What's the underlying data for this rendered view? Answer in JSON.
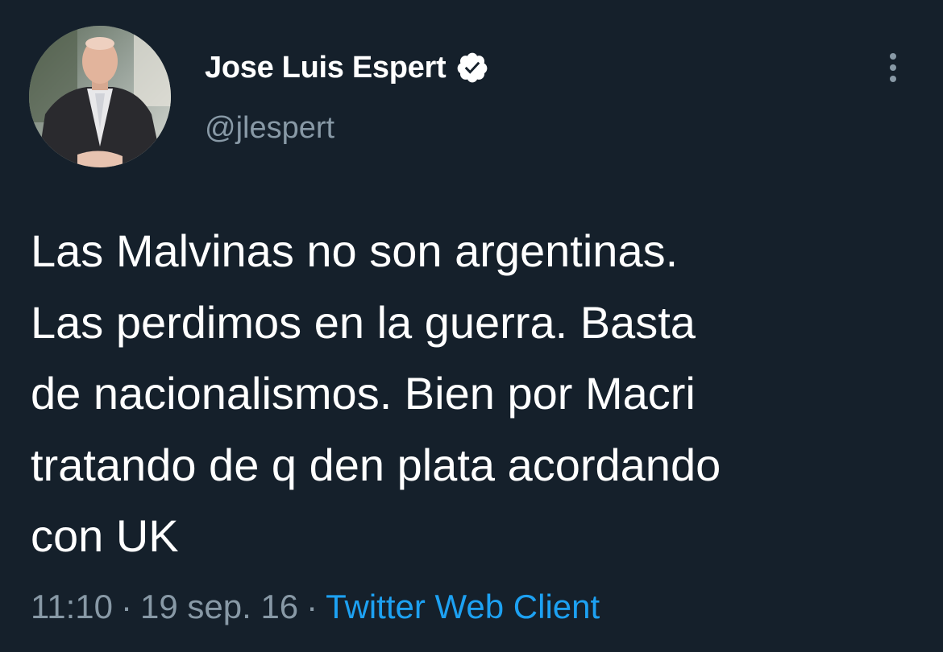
{
  "tweet": {
    "author": {
      "display_name": "Jose Luis Espert",
      "handle": "@jlespert",
      "verified": true,
      "verified_icon": "verified-badge-icon",
      "avatar_icon": "avatar"
    },
    "more_icon": "more-vertical-icon",
    "text_lines": [
      "Las Malvinas no son argentinas.",
      "Las perdimos en la guerra. Basta",
      "de nacionalismos. Bien por Macri",
      "tratando de q den plata acordando",
      "con UK"
    ],
    "meta": {
      "time": "11:10",
      "separator": "·",
      "date": "19 sep. 16",
      "source": "Twitter Web Client"
    }
  },
  "colors": {
    "background": "#15202b",
    "text": "#ffffff",
    "secondary_text": "#8899a6",
    "link": "#1da1f2"
  }
}
